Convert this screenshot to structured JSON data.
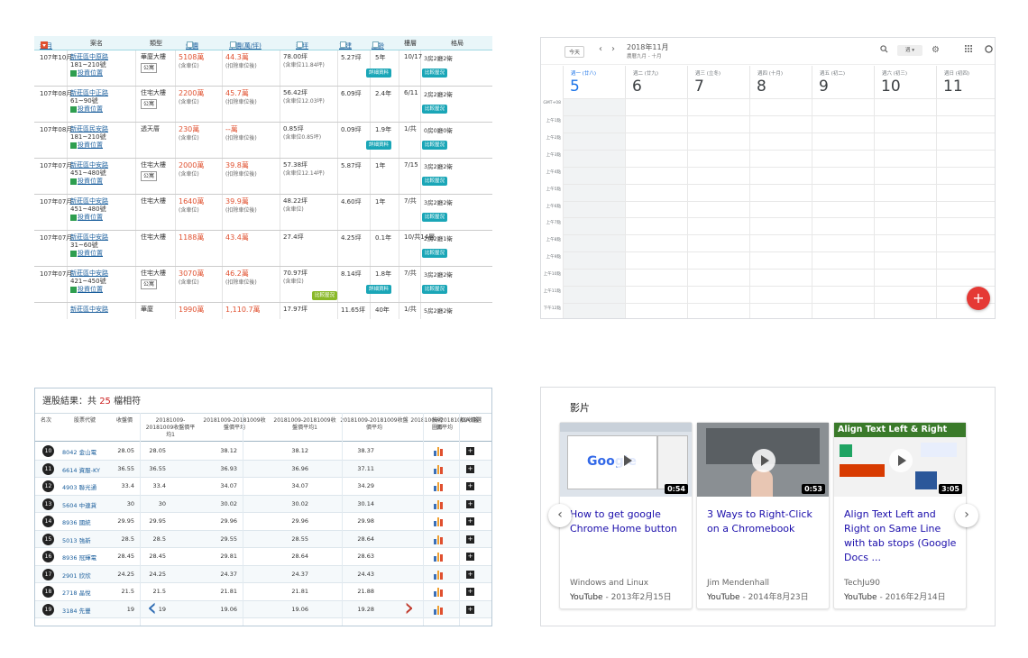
{
  "listing": {
    "headers": {
      "date": "年月",
      "title": "案名",
      "type": "類型",
      "price": "總價",
      "unit_price": "單價(萬/坪)",
      "area": "建坪",
      "main_area": "主建",
      "age": "屋齡",
      "floor": "樓層",
      "layout": "格局"
    },
    "rows": [
      {
        "date": "107年10月",
        "title": "新莊區中原路",
        "sub": "181~210號",
        "tag": "投資位置",
        "type": "華廈大樓",
        "type_btn": "公寓",
        "price": "5108萬",
        "price_note": "(含車位)",
        "unit": "44.3萬",
        "unit_note": "(扣除車位後)",
        "area": "78.00坪",
        "area_note": "(含車位11.84坪)",
        "main": "5.27坪",
        "age": "5年",
        "floor": "10/17",
        "layout": "3房2廳2衛",
        "btn1": "詳細資料",
        "btn2": "比較屋況"
      },
      {
        "date": "107年08月",
        "title": "新莊區中正路",
        "sub": "61~90號",
        "tag": "投資位置",
        "type": "住宅大樓",
        "type_btn": "公寓",
        "price": "2200萬",
        "price_note": "(含車位)",
        "unit": "45.7萬",
        "unit_note": "(扣除車位後)",
        "area": "56.42坪",
        "area_note": "(含車位12.03坪)",
        "main": "6.09坪",
        "age": "2.4年",
        "floor": "6/11",
        "layout": "2房2廳2衛",
        "btn1": "",
        "btn2": "比較屋況"
      },
      {
        "date": "107年08月",
        "title": "新莊區民安路",
        "sub": "181~210號",
        "tag": "投資位置",
        "type": "透天厝",
        "type_btn": "",
        "price": "230萬",
        "price_note": "(含車位)",
        "unit": "--萬",
        "unit_note": "(扣除車位後)",
        "area": "0.85坪",
        "area_note": "(含車位0.85坪)",
        "main": "0.09坪",
        "age": "1.9年",
        "floor": "1/共",
        "layout": "0房0廳0衛",
        "btn1": "詳細資料",
        "btn2": "比較屋況"
      },
      {
        "date": "107年07月",
        "title": "新莊區中安路",
        "sub": "451~480號",
        "tag": "投資位置",
        "type": "住宅大樓",
        "type_btn": "公寓",
        "price": "2000萬",
        "price_note": "(含車位)",
        "unit": "39.8萬",
        "unit_note": "(扣除車位後)",
        "area": "57.38坪",
        "area_note": "(含車位12.14坪)",
        "main": "5.87坪",
        "age": "1年",
        "floor": "7/15",
        "layout": "3房2廳2衛",
        "btn1": "",
        "btn2": "比較屋況"
      },
      {
        "date": "107年07月",
        "title": "新莊區中安路",
        "sub": "451~480號",
        "tag": "投資位置",
        "type": "住宅大樓",
        "type_btn": "",
        "price": "1640萬",
        "price_note": "(含車位)",
        "unit": "39.9萬",
        "unit_note": "(扣除車位後)",
        "area": "48.22坪",
        "area_note": "(含車位)",
        "main": "4.60坪",
        "age": "1年",
        "floor": "7/共",
        "layout": "3房2廳2衛",
        "btn1": "",
        "btn2": "比較屋況"
      },
      {
        "date": "107年07月",
        "title": "新莊區中安路",
        "sub": "31~60號",
        "tag": "投資位置",
        "type": "住宅大樓",
        "type_btn": "",
        "price": "1188萬",
        "price_note": "",
        "unit": "43.4萬",
        "unit_note": "",
        "area": "27.4坪",
        "area_note": "",
        "main": "4.25坪",
        "age": "0.1年",
        "floor": "10/共14層",
        "layout": "2房2廳1衛",
        "btn1": "",
        "btn2": "比較屋況"
      },
      {
        "date": "107年07月",
        "title": "新莊區中安路",
        "sub": "421~450號",
        "tag": "投資位置",
        "type": "住宅大樓",
        "type_btn": "公寓",
        "price": "3070萬",
        "price_note": "(含車位)",
        "unit": "46.2萬",
        "unit_note": "(扣除車位後)",
        "area": "70.97坪",
        "area_note": "(含車位)",
        "main": "8.14坪",
        "age": "1.8年",
        "floor": "7/共",
        "layout": "3房2廳2衛",
        "btn1": "詳細資料",
        "btn2": "比較屋況",
        "btn0": "比較屋況"
      },
      {
        "date": "",
        "title": "新莊區中安路",
        "sub": "",
        "tag": "",
        "type": "華廈",
        "type_btn": "",
        "price": "1990萬",
        "price_note": "",
        "unit": "1,110.7萬",
        "unit_note": "",
        "area": "17.97坪",
        "area_note": "",
        "main": "11.65坪",
        "age": "40年",
        "floor": "1/共",
        "layout": "5房2廳2衛",
        "btn1": "",
        "btn2": ""
      }
    ]
  },
  "calendar": {
    "today_label": "今天",
    "month": "2018年11月",
    "lunar": "農曆九月 - 十月",
    "view": "週",
    "days": [
      {
        "name": "週一 (廿八)",
        "num": "5"
      },
      {
        "name": "週二 (廿九)",
        "num": "6"
      },
      {
        "name": "週三 (立冬)",
        "num": "7"
      },
      {
        "name": "週四 (十月)",
        "num": "8"
      },
      {
        "name": "週五 (初二)",
        "num": "9"
      },
      {
        "name": "週六 (初三)",
        "num": "10"
      },
      {
        "name": "週日 (初四)",
        "num": "11"
      }
    ],
    "hours": [
      "GMT+08",
      "上午1點",
      "上午2點",
      "上午3點",
      "上午4點",
      "上午5點",
      "上午6點",
      "上午7點",
      "上午8點",
      "上午9點",
      "上午10點",
      "上午11點",
      "下午12點"
    ]
  },
  "stocks": {
    "title_prefix": "選股結果：共",
    "count": "25",
    "title_suffix": "檔相符",
    "headers": [
      "名次",
      "股票代號",
      "收盤價",
      "20181009-20181009收盤價平均1",
      "20181009-20181009收盤價平均",
      "20181009-20181009收盤價平均1",
      "20181009-20181009收盤價平均",
      "20181009-20181009收盤價平均",
      "技術圖形",
      "加入自選"
    ],
    "rows": [
      {
        "rank": "10",
        "stock": "8042 金山電",
        "close": "28.05",
        "a": "28.05",
        "b": "38.12",
        "c": "38.12",
        "d": "38.37"
      },
      {
        "rank": "11",
        "stock": "6614 資服-KY",
        "close": "36.55",
        "a": "36.55",
        "b": "36.93",
        "c": "36.96",
        "d": "37.11"
      },
      {
        "rank": "12",
        "stock": "4903 聯光通",
        "close": "33.4",
        "a": "33.4",
        "b": "34.07",
        "c": "34.07",
        "d": "34.29"
      },
      {
        "rank": "13",
        "stock": "5604 中連貨",
        "close": "30",
        "a": "30",
        "b": "30.02",
        "c": "30.02",
        "d": "30.14"
      },
      {
        "rank": "14",
        "stock": "8936 國統",
        "close": "29.95",
        "a": "29.95",
        "b": "29.96",
        "c": "29.96",
        "d": "29.98"
      },
      {
        "rank": "15",
        "stock": "5013 強新",
        "close": "28.5",
        "a": "28.5",
        "b": "29.55",
        "c": "28.55",
        "d": "28.64"
      },
      {
        "rank": "16",
        "stock": "8936 冠輝電",
        "close": "28.45",
        "a": "28.45",
        "b": "29.81",
        "c": "28.64",
        "d": "28.63"
      },
      {
        "rank": "17",
        "stock": "2901 欣欣",
        "close": "24.25",
        "a": "24.25",
        "b": "24.37",
        "c": "24.37",
        "d": "24.43"
      },
      {
        "rank": "18",
        "stock": "2718 晶悅",
        "close": "21.5",
        "a": "21.5",
        "b": "21.81",
        "c": "21.81",
        "d": "21.88"
      },
      {
        "rank": "19",
        "stock": "3184 先豐",
        "close": "19",
        "a": "19",
        "b": "19.06",
        "c": "19.06",
        "d": "19.28"
      }
    ]
  },
  "videos": {
    "section_title": "影片",
    "items": [
      {
        "title": "How to get google Chrome Home button",
        "channel": "Windows and Linux",
        "source": "YouTube",
        "date": "2013年2月15日",
        "duration": "0:54",
        "thumb_text": "Google"
      },
      {
        "title": "3 Ways to Right-Click on a Chromebook",
        "channel": "Jim Mendenhall",
        "source": "YouTube",
        "date": "2014年8月23日",
        "duration": "0:53",
        "thumb_text": ""
      },
      {
        "title": "Align Text Left and Right on Same Line with tab stops (Google Docs ...",
        "channel": "TechJu90",
        "source": "YouTube",
        "date": "2016年2月14日",
        "duration": "3:05",
        "thumb_text": "Align Text Left & Right"
      }
    ]
  }
}
